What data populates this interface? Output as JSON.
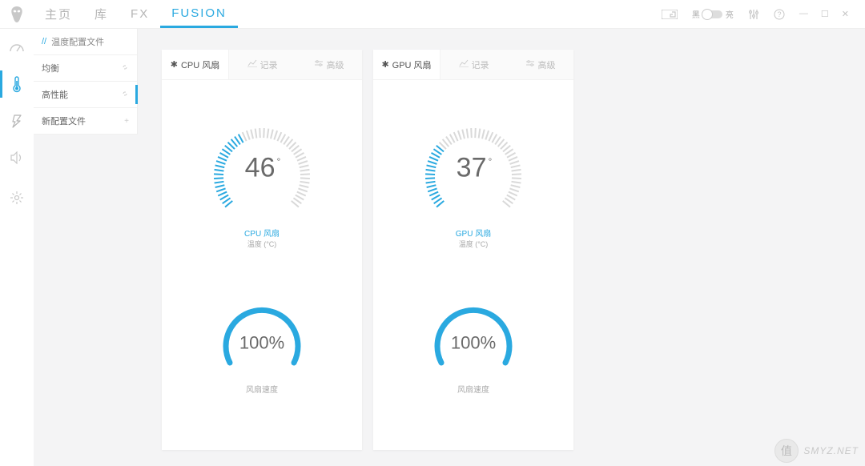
{
  "nav": {
    "items": [
      "主页",
      "库",
      "FX",
      "FUSION"
    ],
    "active_index": 3
  },
  "toggle": {
    "left": "黑",
    "right": "亮"
  },
  "sidebar": {
    "header": "温度配置文件",
    "items": [
      {
        "label": "均衡",
        "action_icon": "link"
      },
      {
        "label": "高性能",
        "action_icon": "link",
        "active": true
      },
      {
        "label": "新配置文件",
        "action_icon": "plus"
      }
    ]
  },
  "cards": [
    {
      "tabs": [
        "CPU 风扇",
        "记录",
        "高级"
      ],
      "active_tab": 0,
      "temp_value": "46",
      "gauge_title_prefix": "CPU",
      "gauge_title_suffix": "风扇",
      "gauge_sub": "温度 (°C)",
      "speed_value": "100%",
      "speed_label": "风扇速度",
      "gauge_fill_ticks": 20
    },
    {
      "tabs": [
        "GPU 风扇",
        "记录",
        "高级"
      ],
      "active_tab": 0,
      "temp_value": "37",
      "gauge_title_prefix": "GPU",
      "gauge_title_suffix": "风扇",
      "gauge_sub": "温度 (°C)",
      "speed_value": "100%",
      "speed_label": "风扇速度",
      "gauge_fill_ticks": 16
    }
  ],
  "watermark": {
    "text": "SMYZ.NET",
    "badge": "值"
  }
}
